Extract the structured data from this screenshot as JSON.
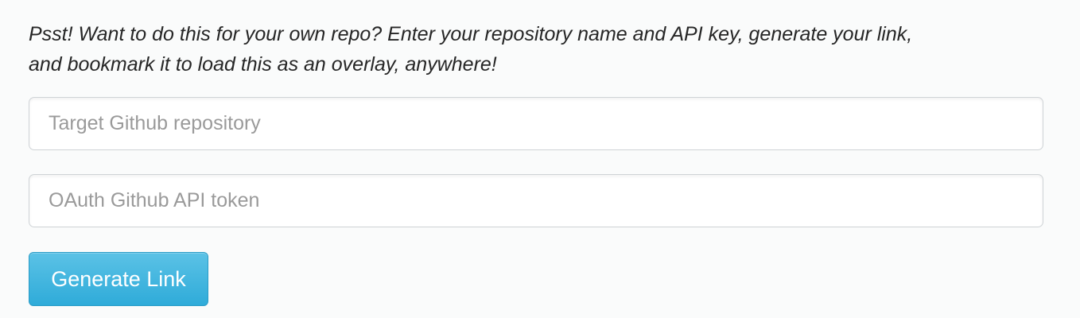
{
  "intro": {
    "line1": "Psst! Want to do this for your own repo? Enter your repository name and API key, generate your link,",
    "line2": "and bookmark it to load this as an overlay, anywhere!"
  },
  "form": {
    "repo_placeholder": "Target Github repository",
    "repo_value": "",
    "token_placeholder": "OAuth Github API token",
    "token_value": "",
    "generate_label": "Generate Link"
  },
  "colors": {
    "button": "#2fabd9",
    "background": "#fafbfb"
  }
}
